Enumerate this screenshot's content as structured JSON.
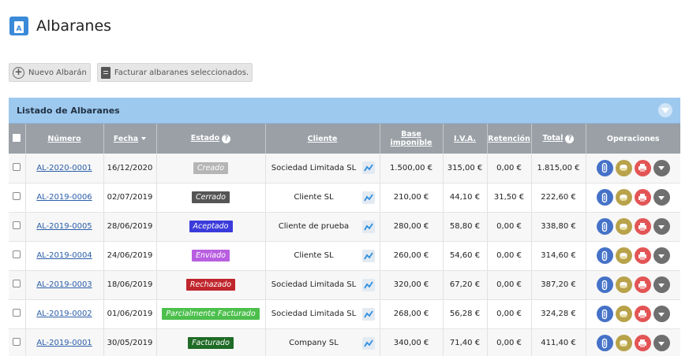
{
  "page": {
    "title": "Albaranes"
  },
  "toolbar": {
    "new_label": "Nuevo Albarán",
    "invoice_label": "Facturar albaranes seleccionados."
  },
  "panel": {
    "title": "Listado de Albaranes"
  },
  "columns": {
    "numero": "Número",
    "fecha": "Fecha",
    "estado": "Estado",
    "cliente": "Cliente",
    "base": "Base imponible",
    "iva": "I.V.A.",
    "retencion": "Retención",
    "total": "Total",
    "operaciones": "Operaciones"
  },
  "status_colors": {
    "Creado": "#b5b5b5",
    "Cerrado": "#555555",
    "Aceptado": "#3b3bdb",
    "Enviado": "#b85ee0",
    "Rechazado": "#c0262d",
    "Parcialmente Facturado": "#4cbf4c",
    "Facturado": "#1f6b27"
  },
  "rows": [
    {
      "numero": "AL-2020-0001",
      "fecha": "16/12/2020",
      "estado": "Creado",
      "cliente": "Sociedad Limitada SL",
      "base": "1.500,00 €",
      "iva": "315,00 €",
      "retencion": "0,00 €",
      "total": "1.815,00 €"
    },
    {
      "numero": "AL-2019-0006",
      "fecha": "02/07/2019",
      "estado": "Cerrado",
      "cliente": "Cliente SL",
      "base": "210,00 €",
      "iva": "44,10 €",
      "retencion": "31,50 €",
      "total": "222,60 €"
    },
    {
      "numero": "AL-2019-0005",
      "fecha": "28/06/2019",
      "estado": "Aceptado",
      "cliente": "Cliente de prueba",
      "base": "280,00 €",
      "iva": "58,80 €",
      "retencion": "0,00 €",
      "total": "338,80 €"
    },
    {
      "numero": "AL-2019-0004",
      "fecha": "24/06/2019",
      "estado": "Enviado",
      "cliente": "Cliente SL",
      "base": "260,00 €",
      "iva": "54,60 €",
      "retencion": "0,00 €",
      "total": "314,60 €"
    },
    {
      "numero": "AL-2019-0003",
      "fecha": "18/06/2019",
      "estado": "Rechazado",
      "cliente": "Sociedad Limitada SL",
      "base": "320,00 €",
      "iva": "67,20 €",
      "retencion": "0,00 €",
      "total": "387,20 €"
    },
    {
      "numero": "AL-2019-0002",
      "fecha": "01/06/2019",
      "estado": "Parcialmente Facturado",
      "cliente": "Sociedad Limitada SL",
      "base": "268,00 €",
      "iva": "56,28 €",
      "retencion": "0,00 €",
      "total": "324,28 €"
    },
    {
      "numero": "AL-2019-0001",
      "fecha": "30/05/2019",
      "estado": "Facturado",
      "cliente": "Company SL",
      "base": "340,00 €",
      "iva": "71,40 €",
      "retencion": "0,00 €",
      "total": "411,40 €"
    }
  ]
}
